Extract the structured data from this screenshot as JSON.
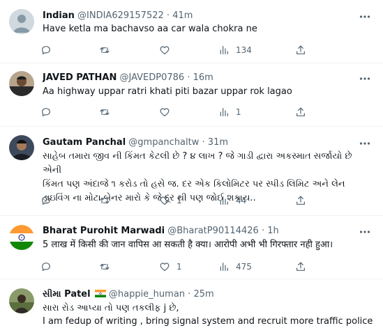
{
  "tweets": [
    {
      "name": "Indian",
      "handle": "@INDIA629157522",
      "dot": "·",
      "time": "41m",
      "lines": [
        "Have ketla ma bachavso aa car wala chokra ne"
      ],
      "replies": "",
      "retweets": "",
      "likes": "",
      "views": "134"
    },
    {
      "name": "JAVED PATHAN",
      "handle": "@JAVEDP0786",
      "dot": "·",
      "time": "16m",
      "lines": [
        "Aa highway uppar ratri khati piti bazar uppar rok lagao"
      ],
      "replies": "",
      "retweets": "",
      "likes": "",
      "views": "1"
    },
    {
      "name": "Gautam Panchal",
      "handle": "@gmpanchaltw",
      "dot": "·",
      "time": "31m",
      "lines": [
        "સાહેબ તમારા જીવ ની કિંમત કેટલી છે ? ૪ લાખ ? જે ગાડી દ્વારા અકસ્માત સર્જાયો છે એની",
        "કિંમત પણ અંદાજે ૧ કરોડ તો હસે જ. દર એક કિલોમિટર પર સ્પીડ લિમિટ અને લેન",
        "ડ્રાઇવિંગ ના મોટા બેનર મારો કે જે દૂર થી પણ જોઈ શકાય.."
      ],
      "replies": "",
      "retweets": "",
      "likes": "1",
      "views": "44"
    },
    {
      "name": "Bharat Purohit Marwadi",
      "handle": "@BharatP90114426",
      "dot": "·",
      "time": "1h",
      "lines": [
        "5 लाख में किसी की जान वापिस आ सकती है क्या। आरोपी अभी भी गिरफ्तार नही हुआ।"
      ],
      "replies": "",
      "retweets": "",
      "likes": "1",
      "views": "475"
    },
    {
      "name": "સીમા Patel",
      "handle": "@happie_human",
      "dot": "·",
      "time": "25m",
      "lines": [
        "સારા રોડ આપ્યા તો પણ તકલીફ j છે,",
        "I am fedup of writing , bring signal system and recruit more traffic police ,"
      ],
      "replies": "",
      "retweets": "",
      "likes": "",
      "views": ""
    }
  ],
  "icons": {
    "more": "more-horizontal-icon",
    "reply": "reply-bubble-icon",
    "retweet": "retweet-arrows-icon",
    "like": "heart-icon",
    "views": "bar-chart-views-icon",
    "share": "share-upload-icon"
  },
  "colors": {
    "text": "#0f1419",
    "muted": "#536471",
    "divider": "#eff3f4"
  }
}
